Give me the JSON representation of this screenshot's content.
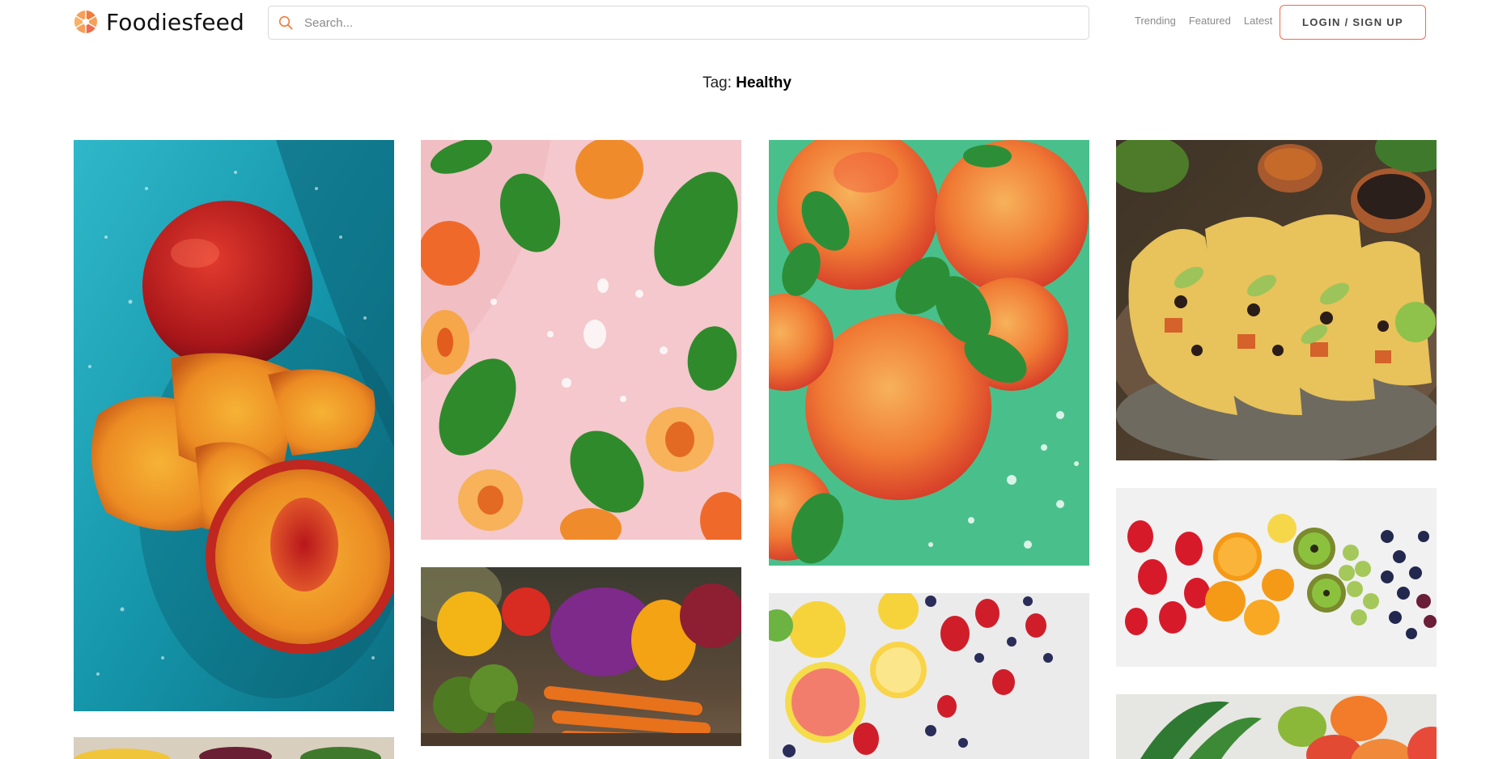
{
  "brand": {
    "name": "Foodiesfeed",
    "accent": "#f07c3c"
  },
  "search": {
    "placeholder": "Search..."
  },
  "nav": {
    "items": [
      "Trending",
      "Featured",
      "Latest"
    ]
  },
  "auth": {
    "login_label": "LOGIN / SIGN UP"
  },
  "page": {
    "tag_prefix": "Tag:",
    "tag_name": "Healthy"
  },
  "photos": [
    {
      "subject": "peaches on blue wet background",
      "icon": "peach-photo"
    },
    {
      "subject": "apricots and spinach leaves on pink",
      "icon": "apricot-photo"
    },
    {
      "subject": "peaches with mint on green",
      "icon": "peach-mint-photo"
    },
    {
      "subject": "sweet potato black bean tacos",
      "icon": "tacos-photo"
    },
    {
      "subject": "vegetables broccoli carrots peppers",
      "icon": "vegetables-photo"
    },
    {
      "subject": "citrus fruits and berries flat lay",
      "icon": "citrus-berries-photo"
    },
    {
      "subject": "rainbow fruit row strawberries oranges kiwi grapes blueberries",
      "icon": "fruit-row-photo"
    },
    {
      "subject": "tropical fruits with palm leaves",
      "icon": "tropical-fruit-photo"
    },
    {
      "subject": "fruit bowl partially visible",
      "icon": "fruit-bowl-photo"
    }
  ]
}
